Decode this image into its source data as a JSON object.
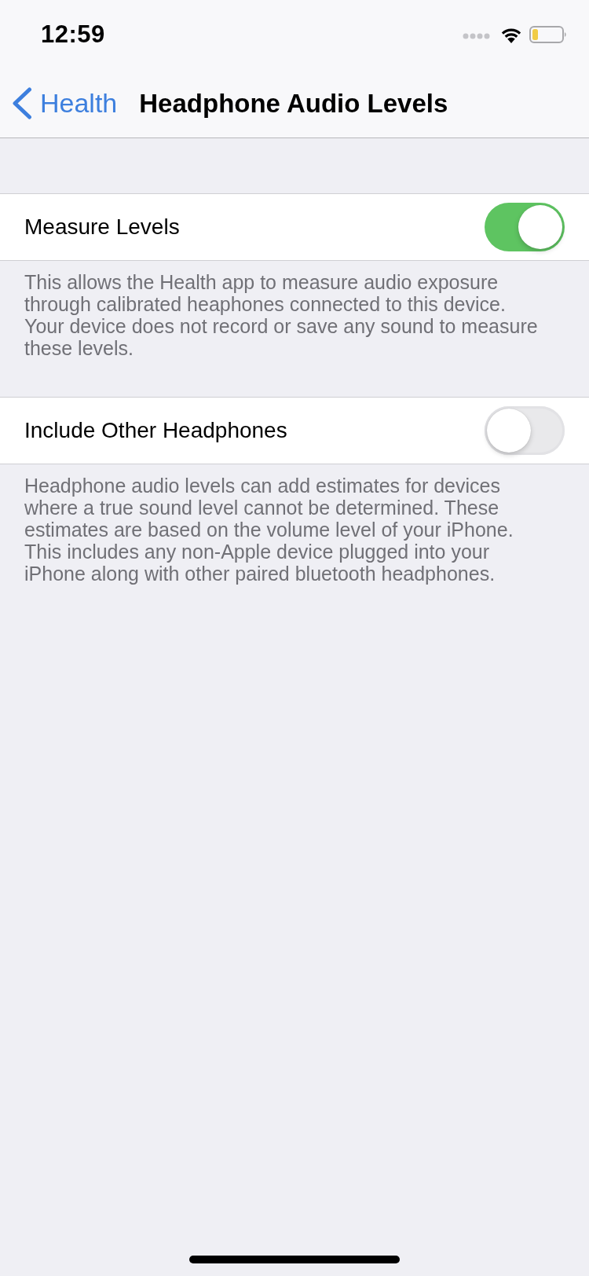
{
  "status_bar": {
    "time": "12:59"
  },
  "nav_bar": {
    "back_label": "Health",
    "title": "Headphone Audio Levels"
  },
  "sections": [
    {
      "label": "Measure Levels",
      "on": true,
      "footer": "This allows the Health app to measure audio exposure through calibrated heaphones connected to this device. Your device does not record or save any sound to measure these levels."
    },
    {
      "label": "Include Other Headphones",
      "on": false,
      "footer": "Headphone audio levels can add estimates for devices where a true sound level cannot be determined. These estimates are based on the volume level of your iPhone. This includes any non-Apple device plugged into your iPhone along with other paired bluetooth headphones."
    }
  ]
}
